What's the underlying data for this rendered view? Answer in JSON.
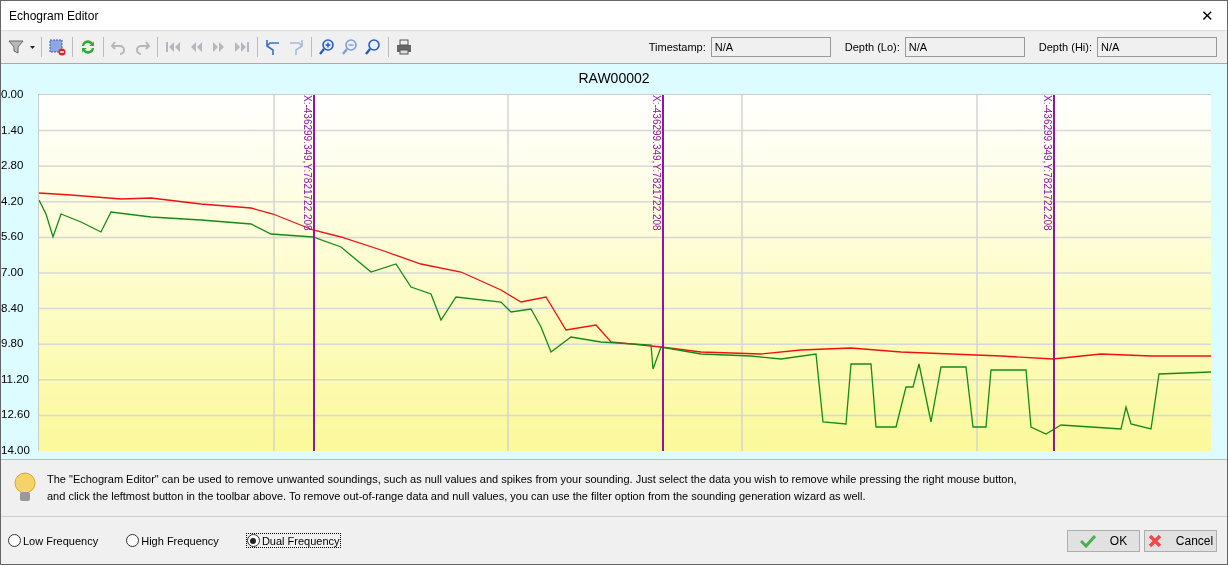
{
  "window": {
    "title": "Echogram Editor",
    "close": "✕"
  },
  "toolbar": {
    "fields": [
      {
        "label": "Timestamp:",
        "value": "N/A"
      },
      {
        "label": "Depth (Lo):",
        "value": "N/A"
      },
      {
        "label": "Depth (Hi):",
        "value": "N/A"
      }
    ]
  },
  "chart": {
    "title": "RAW00002",
    "y_labels": [
      "0.00",
      "1.40",
      "2.80",
      "4.20",
      "5.60",
      "7.00",
      "8.40",
      "9.80",
      "11.20",
      "12.60",
      "14.00"
    ],
    "markers": [
      {
        "label": "X:-436299.349,Y:7821722.208"
      },
      {
        "label": "X:-436299.349,Y:7821722.208"
      },
      {
        "label": "X:-436299.349,Y:7821722.208"
      }
    ]
  },
  "info": "The \"Echogram Editor\" can be used to remove unwanted soundings, such as null values and spikes from your sounding. Just select the data you wish to remove while pressing the right mouse button, and click the leftmost button in the toolbar above. To remove out-of-range data and null values, you can use the filter option from the sounding generation wizard as well.",
  "frequency": [
    {
      "label": "Low Frequency",
      "selected": false
    },
    {
      "label": "High Frequency",
      "selected": false
    },
    {
      "label": "Dual Frequency",
      "selected": true
    }
  ],
  "buttons": [
    {
      "kind": "ok",
      "label": "OK"
    },
    {
      "kind": "cancel",
      "label": "Cancel"
    }
  ]
}
